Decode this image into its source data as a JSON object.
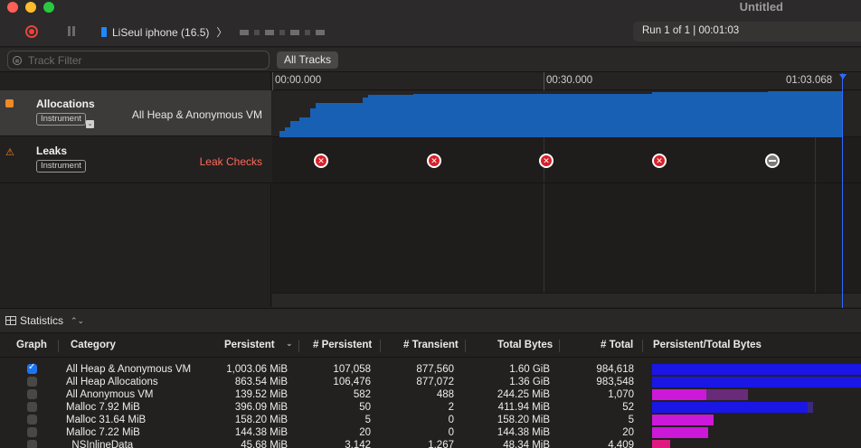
{
  "window": {
    "title": "Untitled"
  },
  "toolbar": {
    "device": "LiSeul iphone (16.5)",
    "device_chevron": "〉",
    "run_status": "Run 1 of 1  |  00:01:03"
  },
  "filter": {
    "placeholder": "Track Filter",
    "all_tracks": "All Tracks"
  },
  "ruler": {
    "t0": "00:00.000",
    "t1": "00:30.000",
    "t2": "01:03.068"
  },
  "tracks": [
    {
      "name": "Allocations",
      "badge": "Instrument",
      "detail": "All Heap & Anonymous VM"
    },
    {
      "name": "Leaks",
      "badge": "Instrument",
      "detail": "Leak Checks"
    }
  ],
  "leak_checks": [
    "fail",
    "fail",
    "fail",
    "fail",
    "none"
  ],
  "stats": {
    "label": "Statistics"
  },
  "columns": {
    "graph": "Graph",
    "category": "Category",
    "persistent": "Persistent",
    "n_persistent": "# Persistent",
    "n_transient": "# Transient",
    "total_bytes": "Total Bytes",
    "n_total": "# Total",
    "ratio": "Persistent/Total Bytes"
  },
  "rows": [
    {
      "checked": true,
      "category": "All Heap & Anonymous VM",
      "persistent": "1,003.06 MiB",
      "n_persistent": "107,058",
      "n_transient": "877,560",
      "total_bytes": "1.60 GiB",
      "n_total": "984,618"
    },
    {
      "checked": false,
      "category": "All Heap Allocations",
      "persistent": "863.54 MiB",
      "n_persistent": "106,476",
      "n_transient": "877,072",
      "total_bytes": "1.36 GiB",
      "n_total": "983,548"
    },
    {
      "checked": false,
      "category": "All Anonymous VM",
      "persistent": "139.52 MiB",
      "n_persistent": "582",
      "n_transient": "488",
      "total_bytes": "244.25 MiB",
      "n_total": "1,070"
    },
    {
      "checked": false,
      "category": "Malloc 7.92 MiB",
      "persistent": "396.09 MiB",
      "n_persistent": "50",
      "n_transient": "2",
      "total_bytes": "411.94 MiB",
      "n_total": "52"
    },
    {
      "checked": false,
      "category": "Malloc 31.64 MiB",
      "persistent": "158.20 MiB",
      "n_persistent": "5",
      "n_transient": "0",
      "total_bytes": "158.20 MiB",
      "n_total": "5"
    },
    {
      "checked": false,
      "category": "Malloc 7.22 MiB",
      "persistent": "144.38 MiB",
      "n_persistent": "20",
      "n_transient": "0",
      "total_bytes": "144.38 MiB",
      "n_total": "20"
    },
    {
      "checked": false,
      "category": "_NSInlineData",
      "persistent": "45.68 MiB",
      "n_persistent": "3,142",
      "n_transient": "1,267",
      "total_bytes": "48.34 MiB",
      "n_total": "4,409"
    }
  ],
  "colors": {
    "accent": "#1e74f0",
    "graph_fill": "#1860b4",
    "bar_blue": "#1a16e6",
    "bar_magenta": "#cc18d8",
    "bar_purple": "#6a2a7a",
    "bar_pink": "#e01880"
  }
}
